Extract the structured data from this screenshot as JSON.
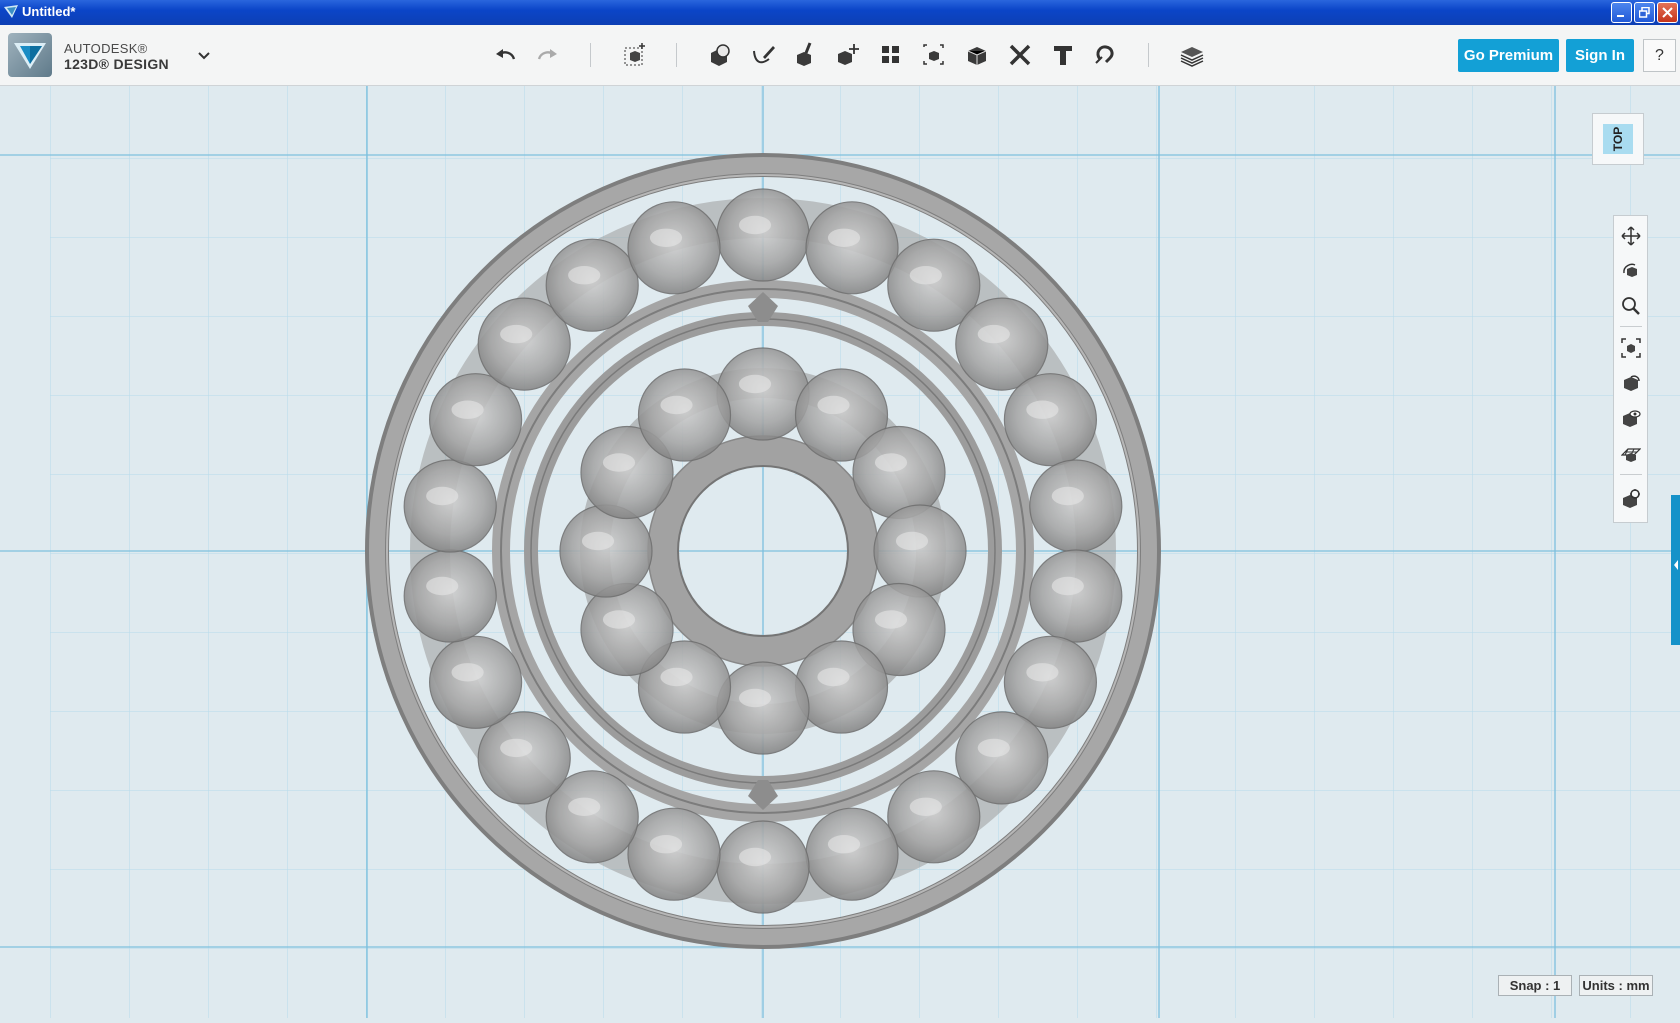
{
  "window": {
    "title": "Untitled*"
  },
  "brand": {
    "line1": "AUTODESK®",
    "line2": "123D® DESIGN"
  },
  "toolbar": {
    "tools": [
      {
        "name": "undo-icon"
      },
      {
        "name": "redo-icon"
      },
      {
        "name": "transform-icon"
      },
      {
        "name": "primitives-icon"
      },
      {
        "name": "sketch-icon"
      },
      {
        "name": "construct-icon"
      },
      {
        "name": "modify-icon"
      },
      {
        "name": "pattern-icon"
      },
      {
        "name": "group-icon"
      },
      {
        "name": "combine-icon"
      },
      {
        "name": "measure-icon"
      },
      {
        "name": "text-icon"
      },
      {
        "name": "snap-icon"
      },
      {
        "name": "materials-icon"
      }
    ],
    "go_premium": "Go Premium",
    "sign_in": "Sign In",
    "help": "?"
  },
  "viewcube": {
    "face_label": "TOP"
  },
  "navbar": {
    "items": [
      "pan-icon",
      "orbit-icon",
      "zoom-icon",
      "fit-icon",
      "perspective-icon",
      "visibility-icon",
      "grid-material-icon",
      "settings-icon"
    ]
  },
  "status": {
    "snap": "Snap : 1",
    "units": "Units : mm"
  },
  "colors": {
    "accent": "#13a0d6",
    "grid_bg": "#dfeaef",
    "grid_line": "#a9d3e6",
    "part_fill": "#a3a3a3"
  }
}
